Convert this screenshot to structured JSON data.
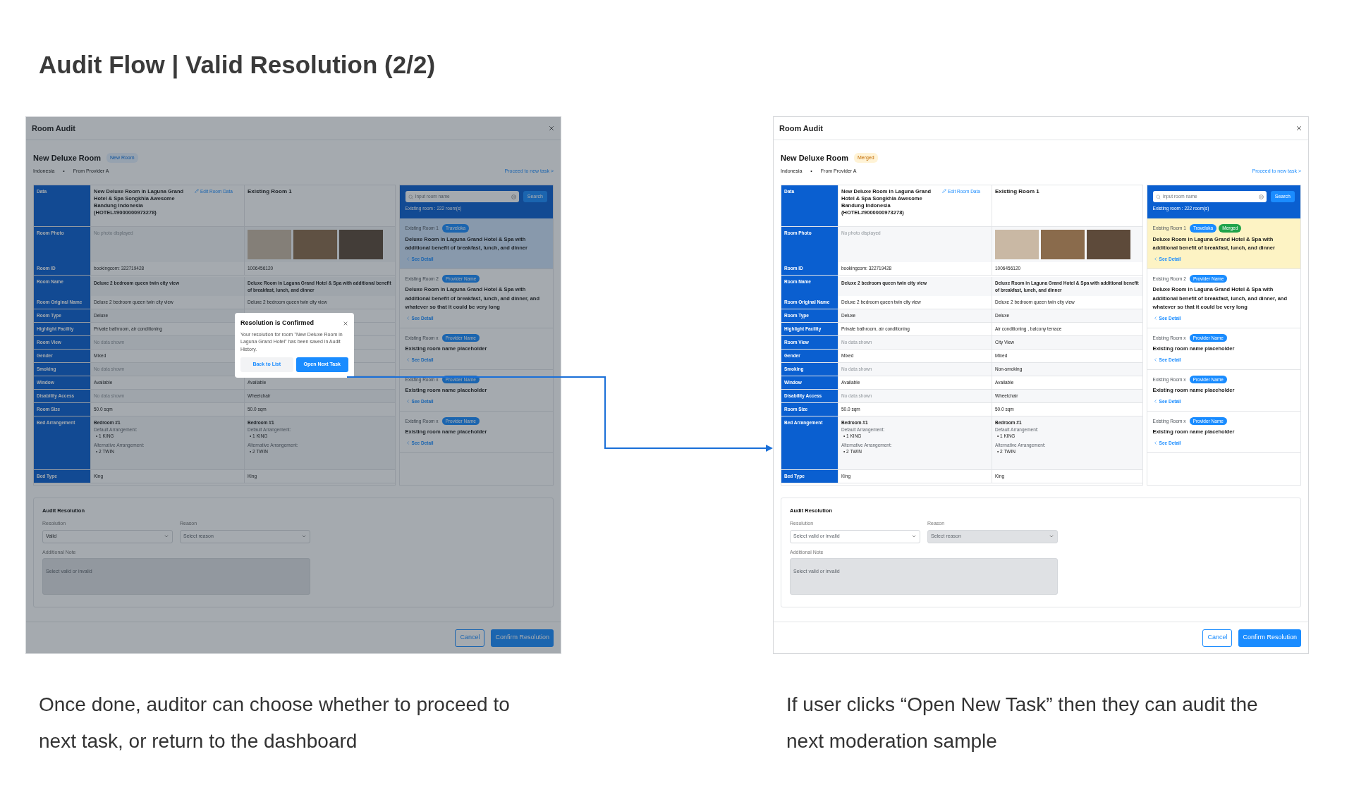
{
  "title": "Audit Flow | Valid Resolution (2/2)",
  "screens": [
    {
      "dimmed": true,
      "window_title": "Room Audit",
      "room": {
        "title": "New Deluxe Room",
        "badge": {
          "text": "New Room",
          "kind": "new"
        }
      },
      "meta": {
        "country": "Indonesia",
        "separator": "•",
        "source": "From Provider A"
      },
      "proceed_link": "Proceed to new task >",
      "rows": [
        {
          "kind": "data",
          "label": "Data",
          "new": {
            "text": "New Deluxe Room in Laguna Grand Hotel & Spa Songkhla Awesome Bandung Indonesia (HOTEL#9000000973278)",
            "link": "Edit Room Data"
          },
          "existing": {
            "text": "Existing Room 1"
          }
        },
        {
          "kind": "photos",
          "label": "Room Photo",
          "new": {
            "text": "No photo displayed",
            "muted": true
          }
        },
        {
          "kind": "text",
          "label": "Room ID",
          "new": {
            "text": "bookingcom: 322719428"
          },
          "existing": {
            "text": "1006456120"
          }
        },
        {
          "kind": "bold",
          "label": "Room Name",
          "new": {
            "text": "Deluxe 2 bedroom queen twin city view"
          },
          "existing": {
            "text": "Deluxe Room in Laguna Grand Hotel & Spa with additional benefit of breakfast, lunch, and dinner"
          }
        },
        {
          "kind": "text",
          "label": "Room Original Name",
          "new": {
            "text": "Deluxe 2 bedroom queen twin city view"
          },
          "existing": {
            "text": "Deluxe 2 bedroom queen twin city view"
          }
        },
        {
          "kind": "text",
          "label": "Room Type",
          "new": {
            "text": "Deluxe"
          }
        },
        {
          "kind": "text",
          "label": "Highlight Facility",
          "new": {
            "text": "Private bathroom, air conditioning"
          }
        },
        {
          "kind": "text",
          "label": "Room View",
          "new": {
            "text": "No data shown",
            "muted": true
          }
        },
        {
          "kind": "text",
          "label": "Gender",
          "new": {
            "text": "Mixed"
          }
        },
        {
          "kind": "text",
          "label": "Smoking",
          "new": {
            "text": "No data shown",
            "muted": true
          }
        },
        {
          "kind": "text",
          "label": "Window",
          "new": {
            "text": "Available"
          },
          "existing": {
            "text": "Available"
          }
        },
        {
          "kind": "text",
          "label": "Disability Access",
          "new": {
            "text": "No data shown",
            "muted": true
          },
          "existing": {
            "text": "Wheelchair"
          }
        },
        {
          "kind": "text",
          "label": "Room Size",
          "new": {
            "text": "50.0 sqm"
          },
          "existing": {
            "text": "50.0 sqm"
          }
        },
        {
          "kind": "beds",
          "label": "Bed Arrangement",
          "new": {
            "bedroom": "Bedroom #1",
            "default_label": "Default Arrangement:",
            "default": [
              "• 1 KING"
            ],
            "alt_label": "Alternative Arrangement:",
            "alt": [
              "• 2 TWIN"
            ]
          },
          "existing": {
            "bedroom": "Bedroom #1",
            "default_label": "Default Arrangement:",
            "default": [
              "• 1 KING"
            ],
            "alt_label": "Alternative Arrangement:",
            "alt": [
              "• 2 TWIN"
            ]
          }
        },
        {
          "kind": "text",
          "label": "Bed Type",
          "new": {
            "text": "King"
          },
          "existing": {
            "text": "King"
          }
        }
      ],
      "list": {
        "placeholder": "Input room name",
        "button": "Search",
        "count": "Existing room : 222 room(s)",
        "cards": [
          {
            "label": "Existing Room 1",
            "badges": [
              {
                "text": "Traveloka",
                "kind": "provider"
              }
            ],
            "title": "Deluxe Room in Laguna Grand Hotel & Spa with additional benefit of breakfast, lunch, and dinner",
            "link": "See Detail",
            "selected": true
          },
          {
            "label": "Existing Room 2",
            "badges": [
              {
                "text": "Provider Name",
                "kind": "provider"
              }
            ],
            "title": "Deluxe Room in Laguna Grand Hotel & Spa with additional benefit of breakfast, lunch, and dinner, and whatever so that it could be very long",
            "link": "See Detail",
            "selected": false
          },
          {
            "label": "Existing Room x",
            "badges": [
              {
                "text": "Provider Name",
                "kind": "provider"
              }
            ],
            "title": "Existing room name placeholder",
            "link": "See Detail",
            "selected": false
          },
          {
            "label": "Existing Room x",
            "badges": [
              {
                "text": "Provider Name",
                "kind": "provider"
              }
            ],
            "title": "Existing room name placeholder",
            "link": "See Detail",
            "selected": false
          },
          {
            "label": "Existing Room x",
            "badges": [
              {
                "text": "Provider Name",
                "kind": "provider"
              }
            ],
            "title": "Existing room name placeholder",
            "link": "See Detail",
            "selected": false
          }
        ]
      },
      "resolution": {
        "title": "Audit Resolution",
        "resolution": {
          "label": "Resolution",
          "value": "Valid"
        },
        "reason": {
          "label": "Reason",
          "placeholder": "Select reason"
        },
        "note": {
          "label": "Additional Note",
          "placeholder": "Select valid or invalid",
          "disabled": true
        }
      },
      "buttons": {
        "cancel": "Cancel",
        "confirm": "Confirm Resolution"
      },
      "dialog": {
        "title": "Resolution is Confirmed",
        "body": "Your resolution for room \"New Deluxe Room in Laguna Grand Hotel\" has been saved in Audit History.",
        "secondary": "Back to List",
        "primary": "Open Next Task"
      },
      "caption": "Once done, auditor can choose whether to proceed to next task, or return to the dashboard"
    },
    {
      "dimmed": false,
      "window_title": "Room Audit",
      "room": {
        "title": "New Deluxe Room",
        "badge": {
          "text": "Merged",
          "kind": "merged"
        }
      },
      "meta": {
        "country": "Indonesia",
        "separator": "•",
        "source": "From Provider A"
      },
      "proceed_link": "Proceed to new task >",
      "rows": [
        {
          "kind": "data",
          "label": "Data",
          "new": {
            "text": "New Deluxe Room in Laguna Grand Hotel & Spa Songkhla Awesome Bandung Indonesia (HOTEL#9000000973278)",
            "link": "Edit Room Data"
          },
          "existing": {
            "text": "Existing Room 1"
          }
        },
        {
          "kind": "photos",
          "label": "Room Photo",
          "new": {
            "text": "No photo displayed",
            "muted": true
          }
        },
        {
          "kind": "text",
          "label": "Room ID",
          "new": {
            "text": "bookingcom: 322719428"
          },
          "existing": {
            "text": "1006456120"
          }
        },
        {
          "kind": "bold",
          "label": "Room Name",
          "new": {
            "text": "Deluxe 2 bedroom queen twin city view"
          },
          "existing": {
            "text": "Deluxe Room in Laguna Grand Hotel & Spa with additional benefit of breakfast, lunch, and dinner"
          }
        },
        {
          "kind": "text",
          "label": "Room Original Name",
          "new": {
            "text": "Deluxe 2 bedroom queen twin city view"
          },
          "existing": {
            "text": "Deluxe 2 bedroom queen twin city view"
          }
        },
        {
          "kind": "text",
          "label": "Room Type",
          "new": {
            "text": "Deluxe"
          },
          "existing": {
            "text": "Deluxe"
          }
        },
        {
          "kind": "text",
          "label": "Highlight Facility",
          "new": {
            "text": "Private bathroom, air conditioning"
          },
          "existing": {
            "text": "Air conditioning , balcony terrace"
          }
        },
        {
          "kind": "text",
          "label": "Room View",
          "new": {
            "text": "No data shown",
            "muted": true
          },
          "existing": {
            "text": "City View"
          }
        },
        {
          "kind": "text",
          "label": "Gender",
          "new": {
            "text": "Mixed"
          },
          "existing": {
            "text": "Mixed"
          }
        },
        {
          "kind": "text",
          "label": "Smoking",
          "new": {
            "text": "No data shown",
            "muted": true
          },
          "existing": {
            "text": "Non-smoking"
          }
        },
        {
          "kind": "text",
          "label": "Window",
          "new": {
            "text": "Available"
          },
          "existing": {
            "text": "Available"
          }
        },
        {
          "kind": "text",
          "label": "Disability Access",
          "new": {
            "text": "No data shown",
            "muted": true
          },
          "existing": {
            "text": "Wheelchair"
          }
        },
        {
          "kind": "text",
          "label": "Room Size",
          "new": {
            "text": "50.0 sqm"
          },
          "existing": {
            "text": "50.0 sqm"
          }
        },
        {
          "kind": "beds",
          "label": "Bed Arrangement",
          "new": {
            "bedroom": "Bedroom #1",
            "default_label": "Default Arrangement:",
            "default": [
              "• 1 KING"
            ],
            "alt_label": "Alternative Arrangement:",
            "alt": [
              "• 2 TWIN"
            ]
          },
          "existing": {
            "bedroom": "Bedroom #1",
            "default_label": "Default Arrangement:",
            "default": [
              "• 1 KING"
            ],
            "alt_label": "Alternative Arrangement:",
            "alt": [
              "• 2 TWIN"
            ]
          }
        },
        {
          "kind": "text",
          "label": "Bed Type",
          "new": {
            "text": "King"
          },
          "existing": {
            "text": "King"
          }
        }
      ],
      "list": {
        "placeholder": "Input room name",
        "button": "Search",
        "count": "Existing room : 222 room(s)",
        "cards": [
          {
            "label": "Existing Room 1",
            "badges": [
              {
                "text": "Traveloka",
                "kind": "provider"
              },
              {
                "text": "Merged",
                "kind": "merged"
              }
            ],
            "title": "Deluxe Room in Laguna Grand Hotel & Spa with additional benefit of breakfast, lunch, and dinner",
            "link": "See Detail",
            "selected": true
          },
          {
            "label": "Existing Room 2",
            "badges": [
              {
                "text": "Provider Name",
                "kind": "provider"
              }
            ],
            "title": "Deluxe Room in Laguna Grand Hotel & Spa with additional benefit of breakfast, lunch, and dinner, and whatever so that it could be very long",
            "link": "See Detail",
            "selected": false
          },
          {
            "label": "Existing Room x",
            "badges": [
              {
                "text": "Provider Name",
                "kind": "provider"
              }
            ],
            "title": "Existing room name placeholder",
            "link": "See Detail",
            "selected": false
          },
          {
            "label": "Existing Room x",
            "badges": [
              {
                "text": "Provider Name",
                "kind": "provider"
              }
            ],
            "title": "Existing room name placeholder",
            "link": "See Detail",
            "selected": false
          },
          {
            "label": "Existing Room x",
            "badges": [
              {
                "text": "Provider Name",
                "kind": "provider"
              }
            ],
            "title": "Existing room name placeholder",
            "link": "See Detail",
            "selected": false
          }
        ]
      },
      "resolution": {
        "title": "Audit Resolution",
        "resolution": {
          "label": "Resolution",
          "placeholder": "Select valid or invalid"
        },
        "reason": {
          "label": "Reason",
          "placeholder": "Select reason",
          "disabled": true
        },
        "note": {
          "label": "Additional Note",
          "placeholder": "Select valid or invalid",
          "disabled": true
        }
      },
      "buttons": {
        "cancel": "Cancel",
        "confirm": "Confirm Resolution"
      },
      "caption": "If user clicks “Open New Task” then they can audit the next moderation sample"
    }
  ]
}
